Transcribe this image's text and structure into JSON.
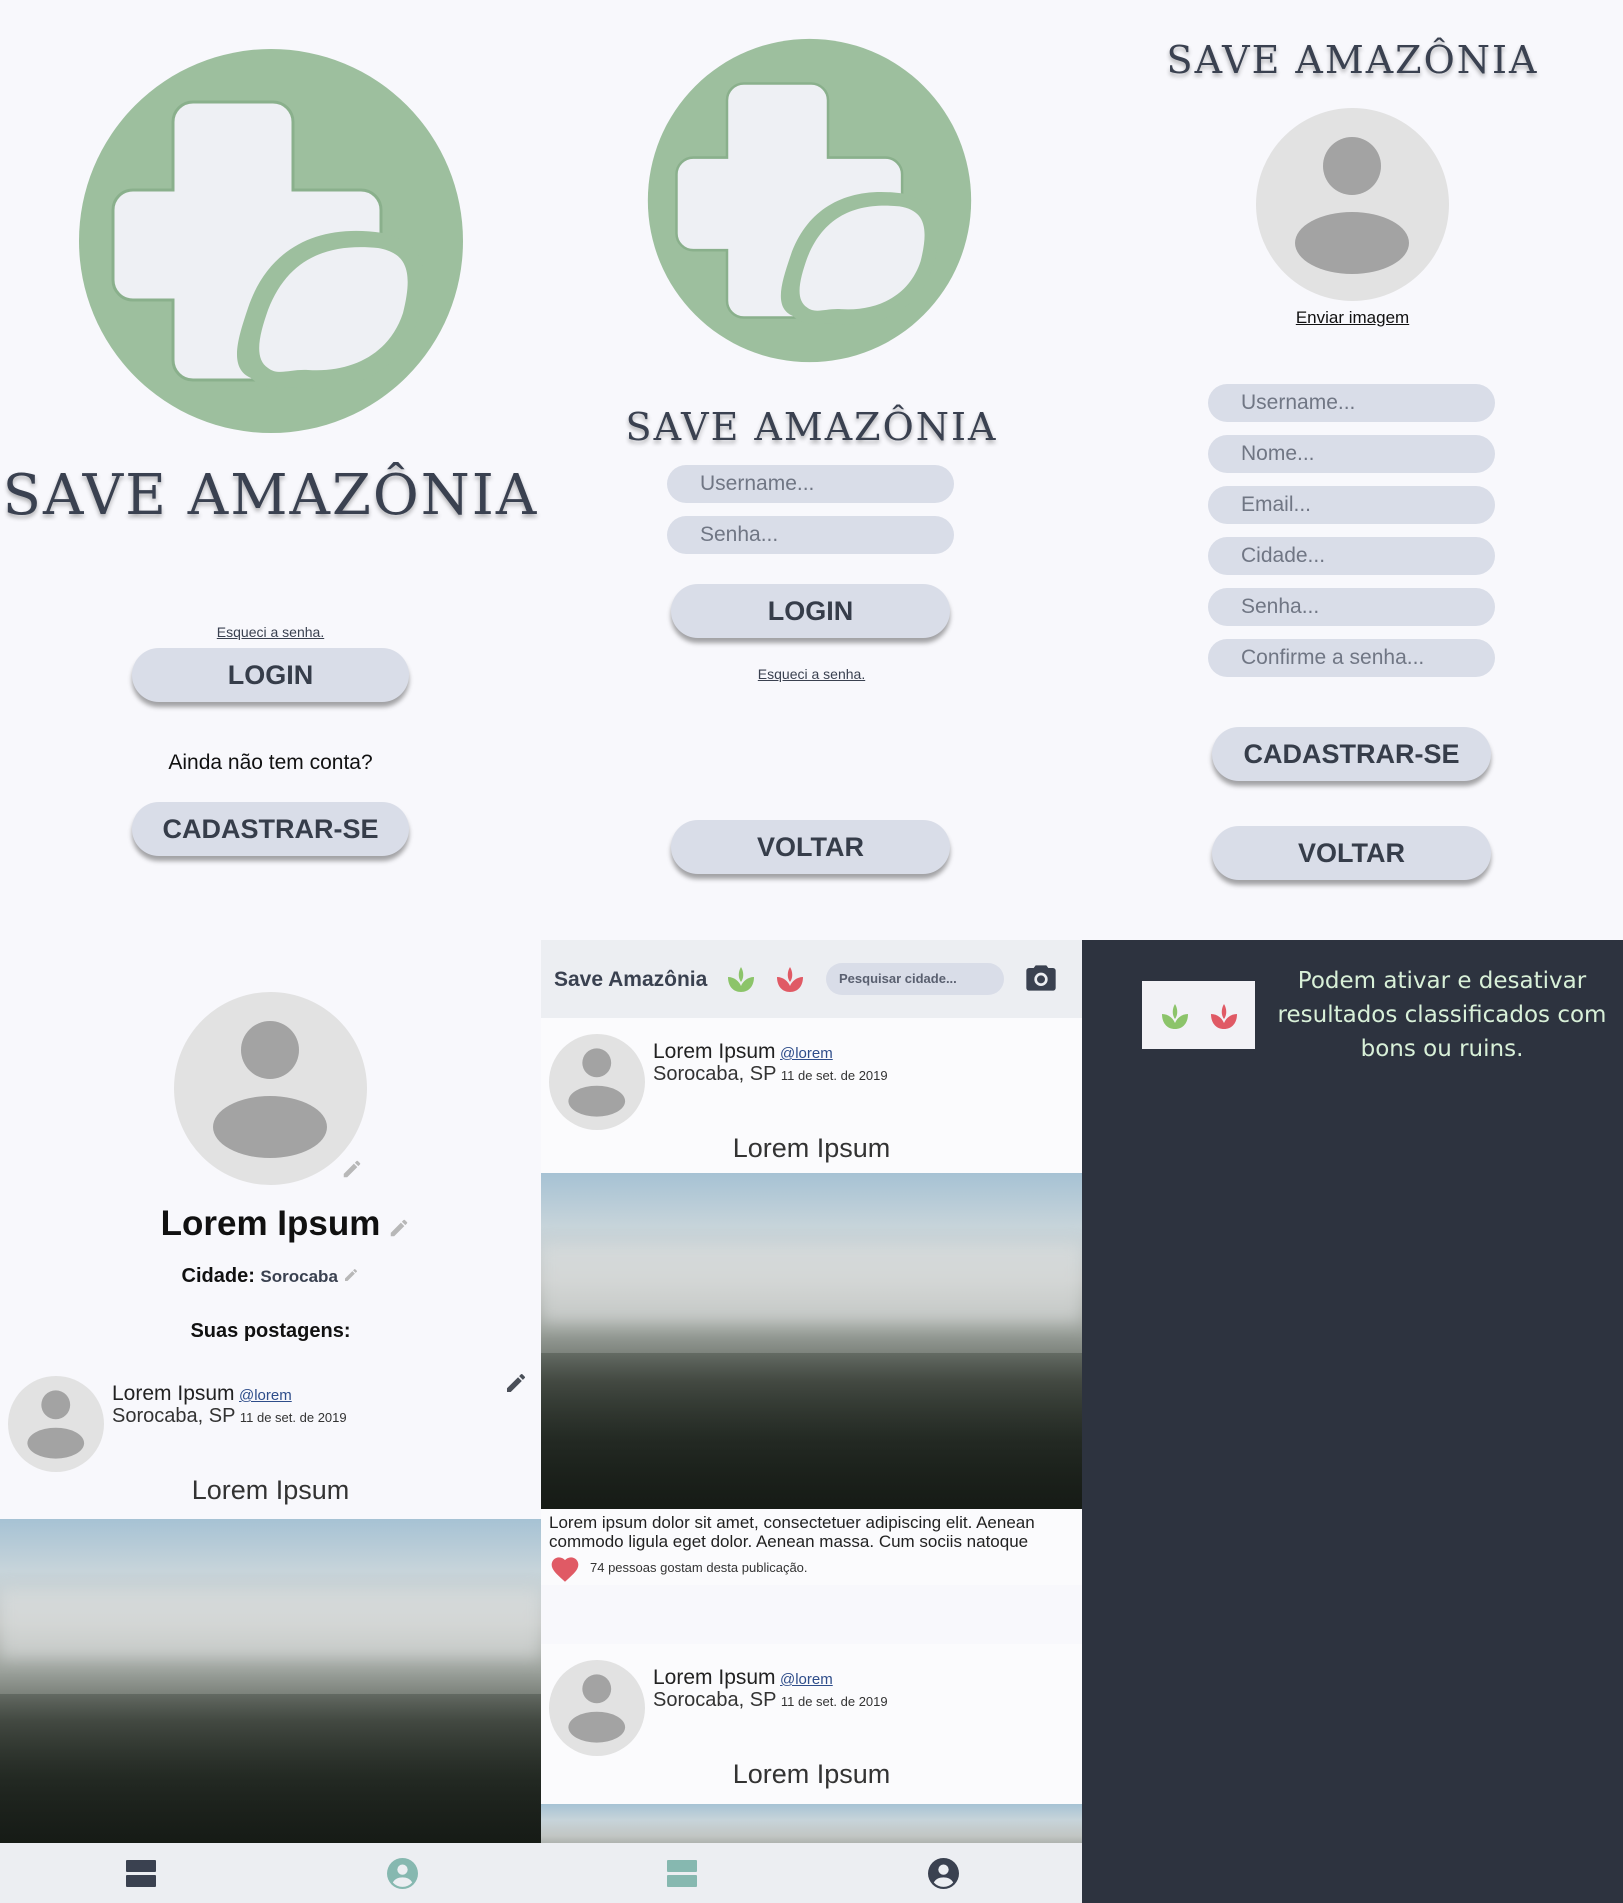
{
  "brand": "SAVE AMAZÔNIA",
  "screen1": {
    "forgot": "Esqueci a senha.",
    "login": "LOGIN",
    "no_account": "Ainda não tem conta?",
    "signup": "CADASTRAR-SE"
  },
  "screen2": {
    "username_placeholder": "Username...",
    "password_placeholder": "Senha...",
    "login": "LOGIN",
    "forgot": "Esqueci a senha.",
    "back": "VOLTAR"
  },
  "screen3": {
    "upload": "Enviar imagem",
    "fields": [
      "Username...",
      "Nome...",
      "Email...",
      "Cidade...",
      "Senha...",
      "Confirme a senha..."
    ],
    "signup": "CADASTRAR-SE",
    "back": "VOLTAR"
  },
  "profile": {
    "name": "Lorem Ipsum",
    "city_label": "Cidade:",
    "city_value": "Sorocaba",
    "posts_label": "Suas postagens:",
    "post": {
      "author": "Lorem Ipsum",
      "handle": "@lorem",
      "city": "Sorocaba, SP",
      "date": "11 de set. de 2019",
      "title": "Lorem Ipsum"
    }
  },
  "feed": {
    "app_title": "Save Amazônia",
    "search_placeholder": "Pesquisar cidade...",
    "posts": [
      {
        "author": "Lorem Ipsum",
        "handle": "@lorem",
        "city": "Sorocaba, SP",
        "date": "11 de set. de 2019",
        "title": "Lorem Ipsum",
        "body": "Lorem ipsum dolor sit amet, consectetuer adipiscing elit. Aenean commodo ligula eget dolor. Aenean massa. Cum sociis natoque penatibus et ma.",
        "likes": "74 pessoas gostam desta publicação."
      },
      {
        "author": "Lorem Ipsum",
        "handle": "@lorem",
        "city": "Sorocaba, SP",
        "date": "11 de set. de 2019",
        "title": "Lorem Ipsum"
      }
    ]
  },
  "note": {
    "text": "Podem ativar e desativar resultados classificados com bons ou ruins."
  },
  "icons": {
    "brand_logo": "medical-cross-leaf-logo",
    "good_filter": "green-plant-icon",
    "bad_filter": "red-plant-icon",
    "camera": "camera-icon",
    "feed_nav": "feed-icon",
    "profile_nav": "profile-icon",
    "edit": "pencil-icon",
    "like": "heart-icon"
  },
  "colors": {
    "logo_green": "#9dbf9e",
    "brand_text": "#3a4150",
    "pill": "#d9dde8",
    "dark_panel": "#2d333f",
    "note_text": "#d8f0d8",
    "good": "#8cc46a",
    "bad": "#e05a65",
    "nav_active": "#86b8b0"
  }
}
